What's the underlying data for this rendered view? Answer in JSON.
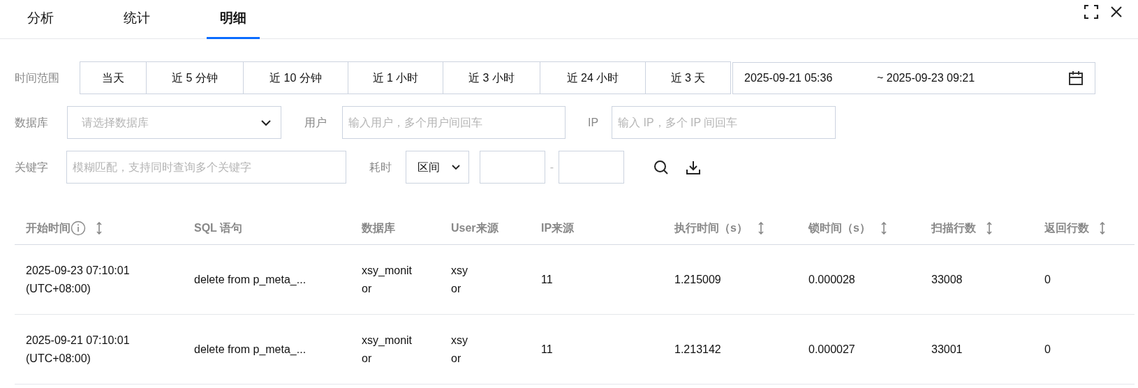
{
  "tabs": [
    {
      "label": "分析",
      "selected": false
    },
    {
      "label": "统计",
      "selected": false
    },
    {
      "label": "明细",
      "selected": true
    }
  ],
  "filters": {
    "time_range": {
      "label": "时间范围",
      "presets": [
        "当天",
        "近 5 分钟",
        "近 10 分钟",
        "近 1 小时",
        "近 3 小时",
        "近 24 小时",
        "近 3 天"
      ],
      "start": "2025-09-21 05:36",
      "end": "~ 2025-09-23 09:21"
    },
    "database": {
      "label": "数据库",
      "placeholder": "请选择数据库"
    },
    "user": {
      "label": "用户",
      "placeholder": "输入用户，多个用户间回车"
    },
    "ip": {
      "label": "IP",
      "placeholder": "输入 IP，多个 IP 间回车"
    },
    "keyword": {
      "label": "关键字",
      "placeholder": "模糊匹配，支持同时查询多个关键字"
    },
    "duration": {
      "label": "耗时",
      "mode": "区间",
      "separator": "-"
    }
  },
  "table": {
    "columns": [
      {
        "label": "开始时间",
        "kind": "info_sortable"
      },
      {
        "label": "SQL 语句",
        "kind": "plain"
      },
      {
        "label": "数据库",
        "kind": "plain"
      },
      {
        "label": "User来源",
        "kind": "plain"
      },
      {
        "label": "IP来源",
        "kind": "plain"
      },
      {
        "label": "执行时间（s）",
        "kind": "sortable"
      },
      {
        "label": "锁时间（s）",
        "kind": "sortable"
      },
      {
        "label": "扫描行数",
        "kind": "sortable"
      },
      {
        "label": "返回行数",
        "kind": "sortable"
      }
    ],
    "rows": [
      {
        "cells": [
          [
            "2025-09-23 07:10:01",
            "(UTC+08:00)"
          ],
          [
            "delete from p_meta_..."
          ],
          [
            "xsy_monit",
            "or"
          ],
          [
            "xsy",
            "or"
          ],
          [
            "11"
          ],
          [
            "1.215009"
          ],
          [
            "0.000028"
          ],
          [
            "33008"
          ],
          [
            "0"
          ]
        ]
      },
      {
        "cells": [
          [
            "2025-09-21 07:10:01",
            "(UTC+08:00)"
          ],
          [
            "delete from p_meta_..."
          ],
          [
            "xsy_monit",
            "or"
          ],
          [
            "xsy",
            "or"
          ],
          [
            "11"
          ],
          [
            "1.213142"
          ],
          [
            "0.000027"
          ],
          [
            "33001"
          ],
          [
            "0"
          ]
        ]
      }
    ]
  }
}
